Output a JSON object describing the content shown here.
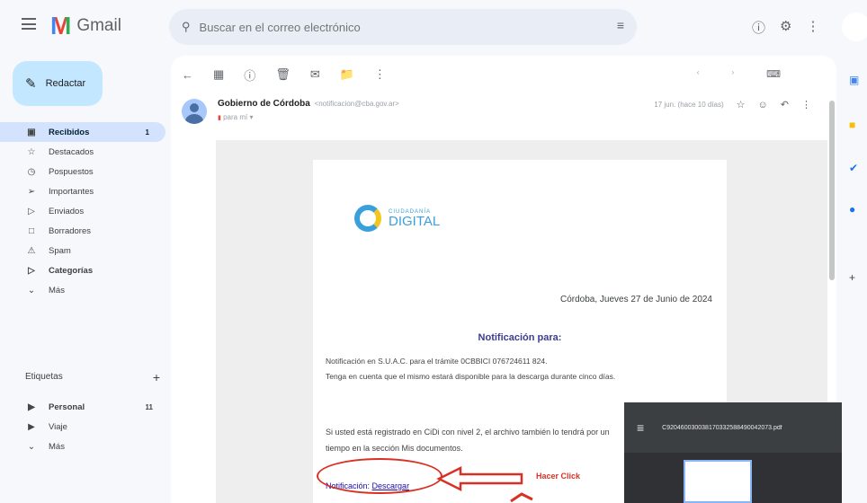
{
  "header": {
    "app_name": "Gmail",
    "search_placeholder": "Buscar en el correo electrónico"
  },
  "sidebar": {
    "compose_label": "Redactar",
    "items": [
      {
        "label": "Recibidos",
        "icon": "inbox-icon",
        "count": "1"
      },
      {
        "label": "Destacados",
        "icon": "star-icon"
      },
      {
        "label": "Pospuestos",
        "icon": "clock-icon"
      },
      {
        "label": "Importantes",
        "icon": "important-icon"
      },
      {
        "label": "Enviados",
        "icon": "send-icon"
      },
      {
        "label": "Borradores",
        "icon": "draft-icon"
      },
      {
        "label": "Spam",
        "icon": "spam-icon"
      },
      {
        "label": "Categorías",
        "icon": "label-icon"
      },
      {
        "label": "Más",
        "icon": "chevron-down-icon"
      }
    ],
    "labels_heading": "Etiquetas",
    "labels": [
      {
        "label": "Personal",
        "count": "11"
      },
      {
        "label": "Viaje"
      },
      {
        "label": "Más"
      }
    ]
  },
  "email": {
    "sender_name": "Gobierno de Córdoba",
    "sender_email": "<notificacion@cba.gov.ar>",
    "to_me": "para mí",
    "timestamp": "17 jun. (hace 10 días)",
    "logo_small": "CIUDADANÍA",
    "logo_big": "DIGITAL",
    "date": "Córdoba, Jueves 27 de Junio de 2024",
    "notif_title": "Notificación para:",
    "paragraph1": "Notificación en S.U.A.C. para el trámite 0CBBICI 076724611 824.",
    "paragraph1b": "Tenga en cuenta que el mismo estará disponible para la descarga durante cinco días.",
    "paragraph2": "Si usted está registrado en CiDi con nivel 2, el archivo también lo tendrá por un tiempo en la sección Mis documentos.",
    "link_label": "Notificación:",
    "link_text": "Descargar",
    "annotation": "Hacer Click"
  },
  "download": {
    "filename": "C920460030038170332588490042073.pdf"
  }
}
